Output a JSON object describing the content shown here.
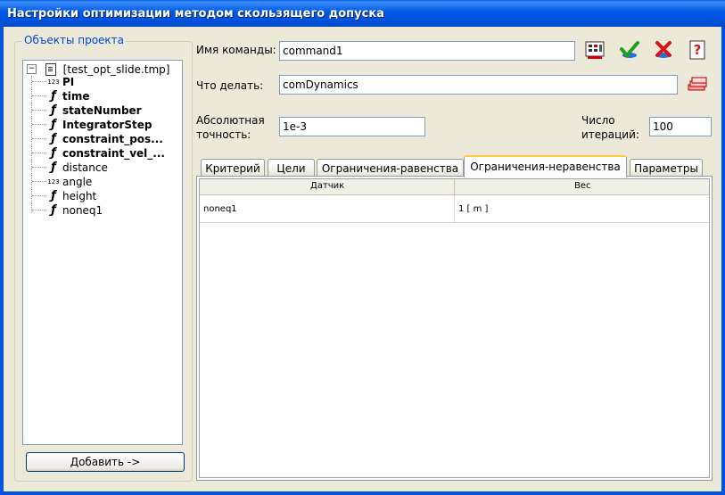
{
  "window": {
    "title": "Настройки оптимизации методом скользящего допуска"
  },
  "project_objects": {
    "group_title": "Объекты проекта",
    "root": {
      "expander": "−",
      "label": "[test_opt_slide.tmp]"
    },
    "items": [
      {
        "icon": "123",
        "label": "PI",
        "bold": true
      },
      {
        "icon": "sym",
        "label": "time",
        "bold": true
      },
      {
        "icon": "sym",
        "label": "stateNumber",
        "bold": true
      },
      {
        "icon": "sym",
        "label": "IntegratorStep",
        "bold": true
      },
      {
        "icon": "sym",
        "label": "constraint_pos...",
        "bold": true
      },
      {
        "icon": "sym",
        "label": "constraint_vel_...",
        "bold": true
      },
      {
        "icon": "sym",
        "label": "distance",
        "bold": false
      },
      {
        "icon": "123",
        "label": "angle",
        "bold": false
      },
      {
        "icon": "sym",
        "label": "height",
        "bold": false
      },
      {
        "icon": "sym",
        "label": "noneq1",
        "bold": false
      }
    ],
    "add_button": "Добавить ->"
  },
  "form": {
    "command_name_label": "Имя команды:",
    "command_name_value": "command1",
    "action_label": "Что делать:",
    "action_value": "comDynamics",
    "abs_accuracy_label_1": "Абсолютная",
    "abs_accuracy_label_2": "точность:",
    "abs_accuracy_value": "1e-3",
    "iterations_label_1": "Число",
    "iterations_label_2": "итераций:",
    "iterations_value": "100"
  },
  "toolbar": {
    "icons": [
      "calculator-icon",
      "check-icon",
      "cancel-icon",
      "help-icon",
      "stack-icon"
    ],
    "colors": {
      "check": "#1FA01F",
      "cancel": "#D81818"
    }
  },
  "tabs": [
    {
      "label": "Критерий",
      "active": false
    },
    {
      "label": "Цели",
      "active": false
    },
    {
      "label": "Ограничения-равенства",
      "active": false
    },
    {
      "label": "Ограничения-неравенства",
      "active": true
    },
    {
      "label": "Параметры",
      "active": false
    }
  ],
  "grid": {
    "columns": [
      "Датчик",
      "Вес"
    ],
    "rows": [
      [
        "noneq1",
        "1  [ m ]"
      ]
    ]
  }
}
